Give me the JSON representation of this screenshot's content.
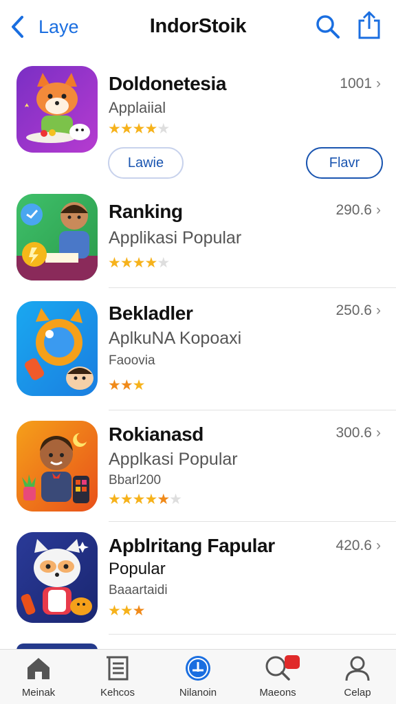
{
  "header": {
    "back_label": "Laye",
    "title": "IndorStoik"
  },
  "apps": [
    {
      "name": "Doldonetesia",
      "subtitle": "Applaiial",
      "meta": "1001",
      "extra": "",
      "rating": 4,
      "buttons": [
        "Lawie",
        "Flavr"
      ]
    },
    {
      "name": "Ranking",
      "subtitle": "Applikasi Popular",
      "meta": "290.6",
      "extra": "",
      "rating": 4
    },
    {
      "name": "Bekladler",
      "subtitle": "AplkuNA Kopoaxi",
      "meta": "250.6",
      "extra": "Faoovia",
      "rating": 3
    },
    {
      "name": "Rokianasd",
      "subtitle": "Applkasi Popular",
      "meta": "300.6",
      "extra": "Bbarl200",
      "rating": 4.5
    },
    {
      "name": "Apblritang Fapular",
      "subtitle": "Popular",
      "meta": "420.6",
      "extra": "Baaartaidi",
      "rating": 3
    }
  ],
  "tabs": [
    {
      "label": "Meinak",
      "icon": "home-icon"
    },
    {
      "label": "Kehcos",
      "icon": "list-icon"
    },
    {
      "label": "Nilanoin",
      "icon": "download-icon"
    },
    {
      "label": "Maeons",
      "icon": "search-badge-icon"
    },
    {
      "label": "Celap",
      "icon": "person-icon"
    }
  ],
  "colors": {
    "accent": "#1a6ee0",
    "star": "#f6b21b",
    "badge": "#e02a2a"
  }
}
